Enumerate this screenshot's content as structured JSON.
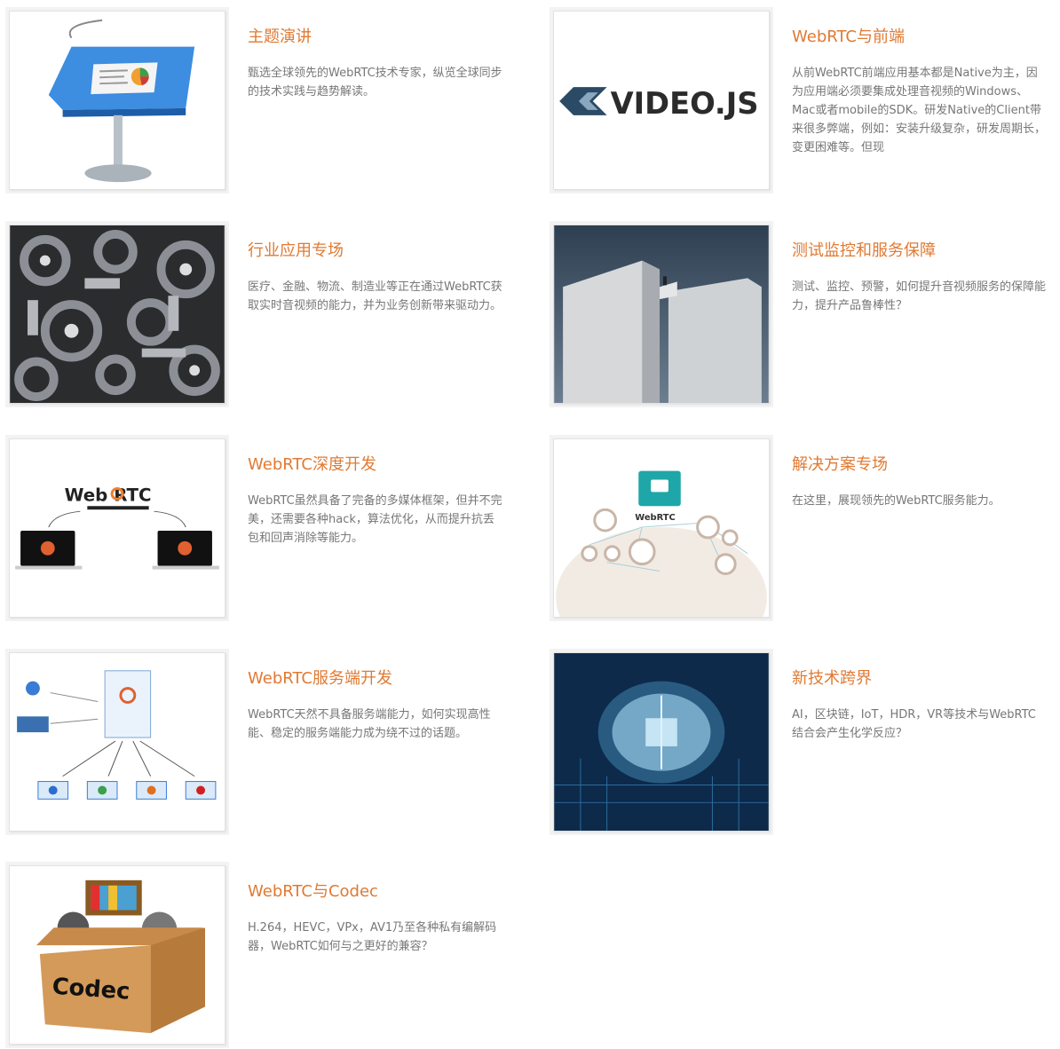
{
  "colors": {
    "accent": "#e07a33",
    "text": "#777777",
    "card_bg": "#f3f3f3"
  },
  "cards": [
    {
      "image": "keynote-podium-icon",
      "title": "主题演讲",
      "desc": "甄选全球领先的WebRTC技术专家，纵览全球同步的技术实践与趋势解读。"
    },
    {
      "image": "videojs-logo",
      "image_text": "VIDEO.JS",
      "title": "WebRTC与前端",
      "desc": "从前WebRTC前端应用基本都是Native为主，因为应用端必须要集成处理音视频的Windows、Mac或者mobile的SDK。研发Native的Client带来很多弊端，例如：安装升级复杂，研发周期长，变更困难等。但现"
    },
    {
      "image": "gears-image",
      "title": "行业应用专场",
      "desc": "医疗、金融、物流、制造业等正在通过WebRTC获取实时音视频的能力，并为业务创新带来驱动力。"
    },
    {
      "image": "monolith-tower-image",
      "title": "测试监控和服务保障",
      "desc": "测试、监控、预警，如何提升音视频服务的保障能力，提升产品鲁棒性？"
    },
    {
      "image": "webrtc-laptops-diagram",
      "image_text": "Web RTC",
      "title": "WebRTC深度开发",
      "desc": "WebRTC虽然具备了完备的多媒体框架，但并不完美，还需要各种hack，算法优化，从而提升抗丢包和回声消除等能力。"
    },
    {
      "image": "webrtc-network-diagram",
      "image_text": "WebRTC",
      "title": "解决方案专场",
      "desc": "在这里，展现领先的WebRTC服务能力。"
    },
    {
      "image": "webrtc-server-diagram",
      "title": "WebRTC服务端开发",
      "desc": "WebRTC天然不具备服务端能力，如何实现高性能、稳定的服务端能力成为绕不过的话题。"
    },
    {
      "image": "ai-brain-chip-image",
      "title": "新技术跨界",
      "desc": "AI，区块链，IoT，HDR，VR等技术与WebRTC结合会产生化学反应？"
    },
    {
      "image": "codec-box-image",
      "image_text": "Codec",
      "title": "WebRTC与Codec",
      "desc": "H.264，HEVC，VPx，AV1乃至各种私有编解码器，WebRTC如何与之更好的兼容？"
    }
  ]
}
